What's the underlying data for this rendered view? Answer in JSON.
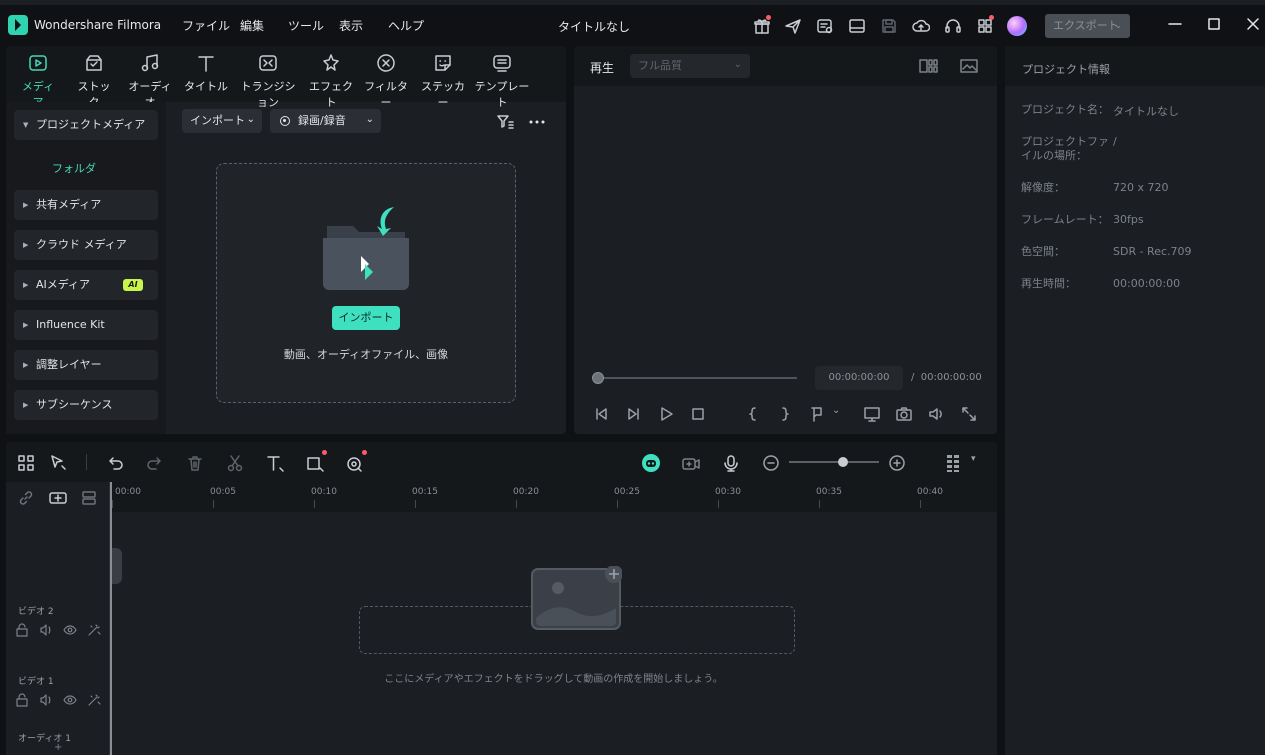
{
  "app": {
    "name": "Wondershare Filmora",
    "document_title": "タイトルなし",
    "export_label": "エクスポート"
  },
  "menu": [
    "ファイル",
    "編集",
    "ツール",
    "表示",
    "ヘルプ"
  ],
  "tabs": [
    {
      "label": "メディア",
      "icon": "media-icon",
      "active": true
    },
    {
      "label": "ストック",
      "icon": "stock-icon"
    },
    {
      "label": "オーディオ",
      "icon": "music-icon"
    },
    {
      "label": "タイトル",
      "icon": "title-icon"
    },
    {
      "label": "トランジション",
      "icon": "transition-icon"
    },
    {
      "label": "エフェクト",
      "icon": "effect-icon"
    },
    {
      "label": "フィルター",
      "icon": "filter-icon"
    },
    {
      "label": "ステッカー",
      "icon": "sticker-icon"
    },
    {
      "label": "テンプレート",
      "icon": "template-icon"
    }
  ],
  "sidebar": {
    "items": [
      {
        "label": "プロジェクトメディア",
        "expanded": true
      },
      {
        "label": "共有メディア"
      },
      {
        "label": "クラウド メディア"
      },
      {
        "label": "AIメディア",
        "badge": "AI"
      },
      {
        "label": "Influence Kit"
      },
      {
        "label": "調整レイヤー"
      },
      {
        "label": "サブシーケンス"
      }
    ],
    "folder_label": "フォルダ"
  },
  "media": {
    "import_dropdown": "インポート",
    "record_dropdown": "録画/録音",
    "import_button": "インポート",
    "drop_text": "動画、オーディオファイル、画像"
  },
  "player": {
    "play_label": "再生",
    "quality": "フル品質",
    "current_time": "00:00:00:00",
    "separator": "/",
    "total_time": "00:00:00:00"
  },
  "project_info": {
    "title": "プロジェクト情報",
    "rows": [
      {
        "label": "プロジェクト名：",
        "value": "タイトルなし"
      },
      {
        "label": "プロジェクトファイルの場所：",
        "value": "/"
      },
      {
        "label": "解像度：",
        "value": "720 x 720"
      },
      {
        "label": "フレームレート：",
        "value": "30fps"
      },
      {
        "label": "色空間：",
        "value": "SDR - Rec.709"
      },
      {
        "label": "再生時間：",
        "value": "00:00:00:00"
      }
    ]
  },
  "timeline": {
    "ruler": [
      "00:00",
      "00:05",
      "00:10",
      "00:15",
      "00:20",
      "00:25",
      "00:30",
      "00:35",
      "00:40"
    ],
    "tracks": [
      "ビデオ 2",
      "ビデオ 1",
      "オーディオ 1"
    ],
    "hint": "ここにメディアやエフェクトをドラッグして動画の作成を開始しましょう。"
  },
  "colors": {
    "accent": "#3fe0c0",
    "background": "#1b1e22",
    "panel_header": "#15181b"
  }
}
